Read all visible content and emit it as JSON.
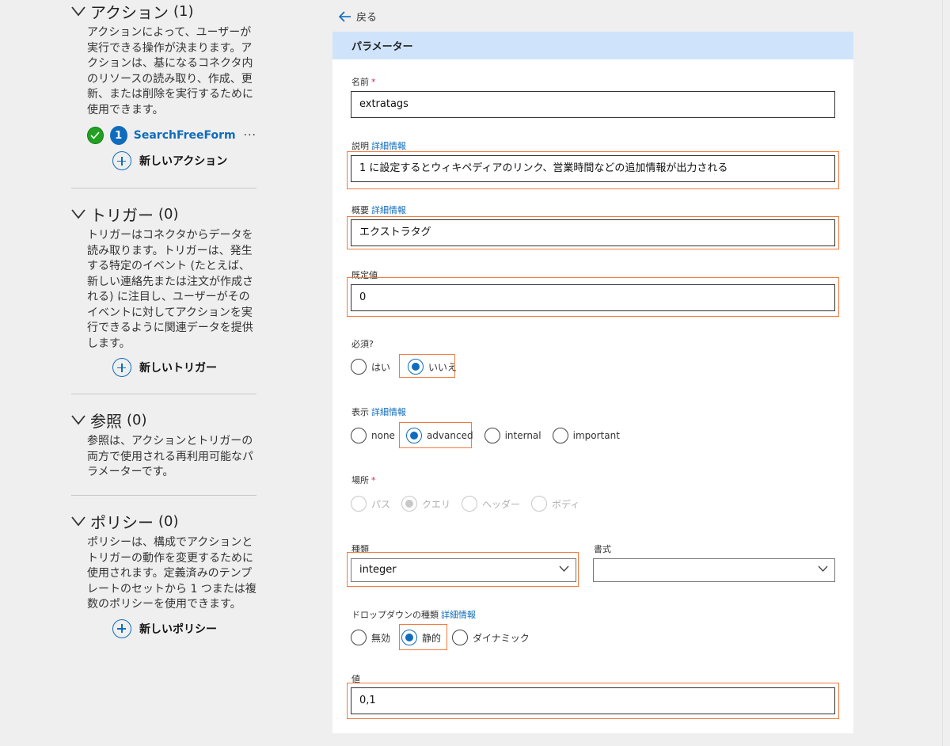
{
  "sidebar": {
    "actions": {
      "title": "アクション",
      "count": "(1)",
      "description": "アクションによって、ユーザーが実行できる操作が決まります。アクションは、基になるコネクタ内のリソースの読み取り、作成、更新、または削除を実行するために使用できます。",
      "item": {
        "number": "1",
        "name": "SearchFreeForm",
        "more": "···"
      },
      "add_label": "新しいアクション"
    },
    "triggers": {
      "title": "トリガー",
      "count": "(0)",
      "description": "トリガーはコネクタからデータを読み取ります。トリガーは、発生する特定のイベント (たとえば、新しい連絡先または注文が作成される) に注目し、ユーザーがそのイベントに対してアクションを実行できるように関連データを提供します。",
      "add_label": "新しいトリガー"
    },
    "references": {
      "title": "参照",
      "count": "(0)",
      "description": "参照は、アクションとトリガーの両方で使用される再利用可能なパラメーターです。"
    },
    "policies": {
      "title": "ポリシー",
      "count": "(0)",
      "description": "ポリシーは、構成でアクションとトリガーの動作を変更するために使用されます。定義済みのテンプレートのセットから 1 つまたは複数のポリシーを使用できます。",
      "add_label": "新しいポリシー"
    }
  },
  "back_label": "戻る",
  "panel": {
    "title": "パラメーター",
    "more_info": "詳細情報",
    "name": {
      "label": "名前",
      "required": "*",
      "value": "extratags"
    },
    "description": {
      "label": "説明",
      "value": "1 に設定するとウィキペディアのリンク、営業時間などの追加情報が出力される"
    },
    "summary": {
      "label": "概要",
      "value": "エクストラタグ"
    },
    "default": {
      "label": "既定値",
      "value": "0"
    },
    "required_q": {
      "label": "必須?",
      "options": [
        "はい",
        "いいえ"
      ],
      "selected": "いいえ"
    },
    "visibility": {
      "label": "表示",
      "options": [
        "none",
        "advanced",
        "internal",
        "important"
      ],
      "selected": "advanced"
    },
    "location": {
      "label": "場所",
      "required": "*",
      "options": [
        "パス",
        "クエリ",
        "ヘッダー",
        "ボディ"
      ],
      "selected": "クエリ"
    },
    "type": {
      "label": "種類",
      "value": "integer"
    },
    "format": {
      "label": "書式",
      "value": ""
    },
    "dropdown_type": {
      "label": "ドロップダウンの種類",
      "options": [
        "無効",
        "静的",
        "ダイナミック"
      ],
      "selected": "静的"
    },
    "values": {
      "label": "値",
      "value": "0,1"
    }
  },
  "colors": {
    "accent": "#0f6cbd",
    "highlight": "#f07b3f",
    "header_bg": "#cfe4fa",
    "success": "#22a022"
  }
}
